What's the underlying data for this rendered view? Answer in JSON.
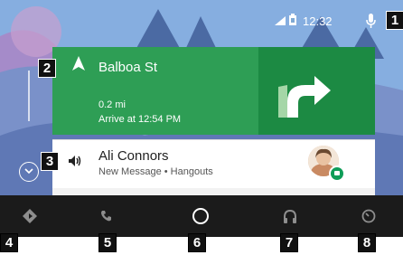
{
  "status_bar": {
    "time": "12:32",
    "signal_icon": "signal-icon",
    "battery_icon": "battery-icon",
    "mic_icon": "microphone-icon"
  },
  "navigation_card": {
    "street": "Balboa St",
    "distance": "0.2 mi",
    "arrival": "Arrive at 12:54 PM",
    "turn_icon": "turn-right-icon",
    "direction_icon": "navigation-arrow-icon",
    "color": "#2e9e55"
  },
  "message_card": {
    "sender": "Ali Connors",
    "subtitle": "New Message • Hangouts",
    "app_icon": "hangouts-icon",
    "speaker_icon": "speaker-icon"
  },
  "nav_bar": {
    "items": [
      {
        "name": "navigation",
        "icon": "navigation-icon"
      },
      {
        "name": "phone",
        "icon": "phone-icon"
      },
      {
        "name": "home",
        "icon": "home-icon"
      },
      {
        "name": "music",
        "icon": "headphones-icon"
      },
      {
        "name": "car",
        "icon": "car-icon"
      }
    ]
  },
  "callouts": [
    "1",
    "2",
    "3",
    "4",
    "5",
    "6",
    "7",
    "8"
  ]
}
